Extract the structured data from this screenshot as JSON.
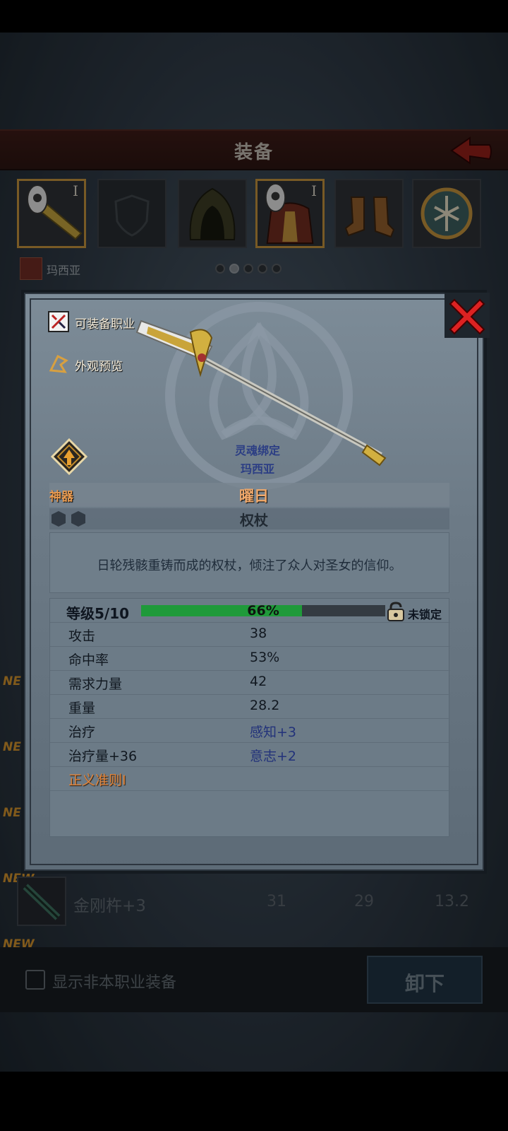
{
  "header": {
    "title": "装备"
  },
  "slots": [
    {
      "rank": "I",
      "icon": "sword-icon",
      "selected": true
    },
    {
      "rank": "",
      "icon": "shield-empty-icon",
      "selected": false
    },
    {
      "rank": "",
      "icon": "hood-icon",
      "selected": false
    },
    {
      "rank": "I",
      "icon": "armor-icon",
      "selected": false
    },
    {
      "rank": "",
      "icon": "boots-icon",
      "selected": false
    },
    {
      "rank": "",
      "icon": "amulet-icon",
      "selected": false
    }
  ],
  "character": {
    "name": "玛西亚"
  },
  "pager": {
    "count": 5,
    "active": 1
  },
  "item": {
    "equip_class_label": "可装备职业",
    "preview_label": "外观预览",
    "soulbound_label": "灵魂绑定",
    "soulbound_owner": "玛西亚",
    "rarity": "神器",
    "name": "曜日",
    "type": "权杖",
    "description": "日轮残骸重铸而成的权杖，倾注了众人对圣女的信仰。",
    "level_label": "等级5/10",
    "level_progress_text": "66%",
    "level_progress": 0.66,
    "lock_status": "未锁定",
    "stats": [
      {
        "label": "攻击",
        "value": "38"
      },
      {
        "label": "命中率",
        "value": "53%"
      },
      {
        "label": "需求力量",
        "value": "42"
      },
      {
        "label": "重量",
        "value": "28.2"
      },
      {
        "label": "治疗",
        "value": "感知+3"
      },
      {
        "label": "治疗量+36",
        "value": "意志+2"
      },
      {
        "label": "正义准则I",
        "value": ""
      }
    ]
  },
  "list": {
    "new_tag": "NEW",
    "item": {
      "name": "金刚杵+3",
      "v1": "31",
      "v2": "29",
      "v3": "13.2"
    }
  },
  "footer": {
    "show_other_class_label": "显示非本职业装备",
    "unequip_label": "卸下"
  },
  "colors": {
    "accent_orange": "#e0843c",
    "progress_green": "#1f9a3a",
    "blue_text": "#22327a"
  }
}
